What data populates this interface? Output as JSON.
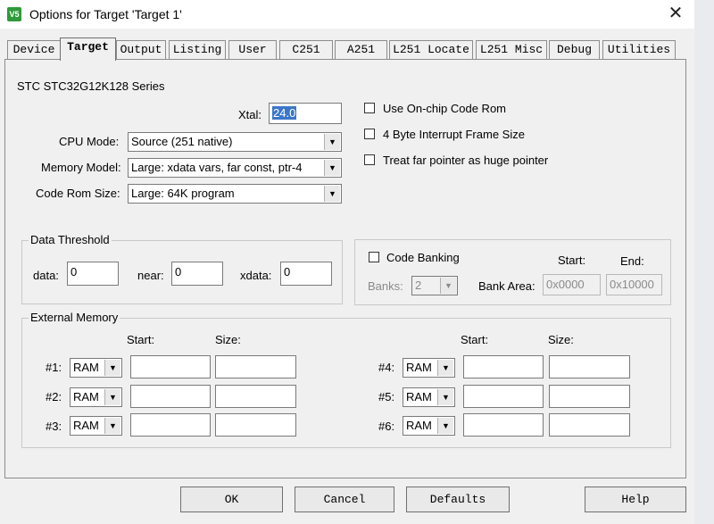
{
  "window": {
    "title": "Options for Target 'Target 1'",
    "close_glyph": "✕",
    "app_icon_label": "V5"
  },
  "tabs": [
    "Device",
    "Target",
    "Output",
    "Listing",
    "User",
    "C251",
    "A251",
    "L251 Locate",
    "L251 Misc",
    "Debug",
    "Utilities"
  ],
  "series_label": "STC STC32G12K128 Series",
  "xtal": {
    "label": "Xtal:",
    "value": "24.0"
  },
  "cpu_mode": {
    "label": "CPU Mode:",
    "value": "Source (251 native)"
  },
  "memory_model": {
    "label": "Memory Model:",
    "value": "Large: xdata vars, far const, ptr-4"
  },
  "code_rom_size": {
    "label": "Code Rom Size:",
    "value": "Large: 64K program"
  },
  "options": {
    "use_onchip": "Use On-chip Code Rom",
    "four_byte": "4 Byte Interrupt Frame Size",
    "treat_far": "Treat far pointer as huge pointer"
  },
  "data_threshold": {
    "title": "Data Threshold",
    "data_label": "data:",
    "data_value": "0",
    "near_label": "near:",
    "near_value": "0",
    "xdata_label": "xdata:",
    "xdata_value": "0"
  },
  "banking": {
    "code_banking": "Code Banking",
    "start_label": "Start:",
    "end_label": "End:",
    "banks_label": "Banks:",
    "banks_value": "2",
    "bank_area_label": "Bank Area:",
    "start_value": "0x0000",
    "end_value": "0x10000"
  },
  "external_memory": {
    "title": "External Memory",
    "start_label": "Start:",
    "size_label": "Size:",
    "rows_left": [
      {
        "label": "#1:",
        "type": "RAM"
      },
      {
        "label": "#2:",
        "type": "RAM"
      },
      {
        "label": "#3:",
        "type": "RAM"
      }
    ],
    "rows_right": [
      {
        "label": "#4:",
        "type": "RAM"
      },
      {
        "label": "#5:",
        "type": "RAM"
      },
      {
        "label": "#6:",
        "type": "RAM"
      }
    ]
  },
  "buttons": {
    "ok": "OK",
    "cancel": "Cancel",
    "defaults": "Defaults",
    "help": "Help"
  },
  "icons": {
    "dropdown": "▼"
  }
}
